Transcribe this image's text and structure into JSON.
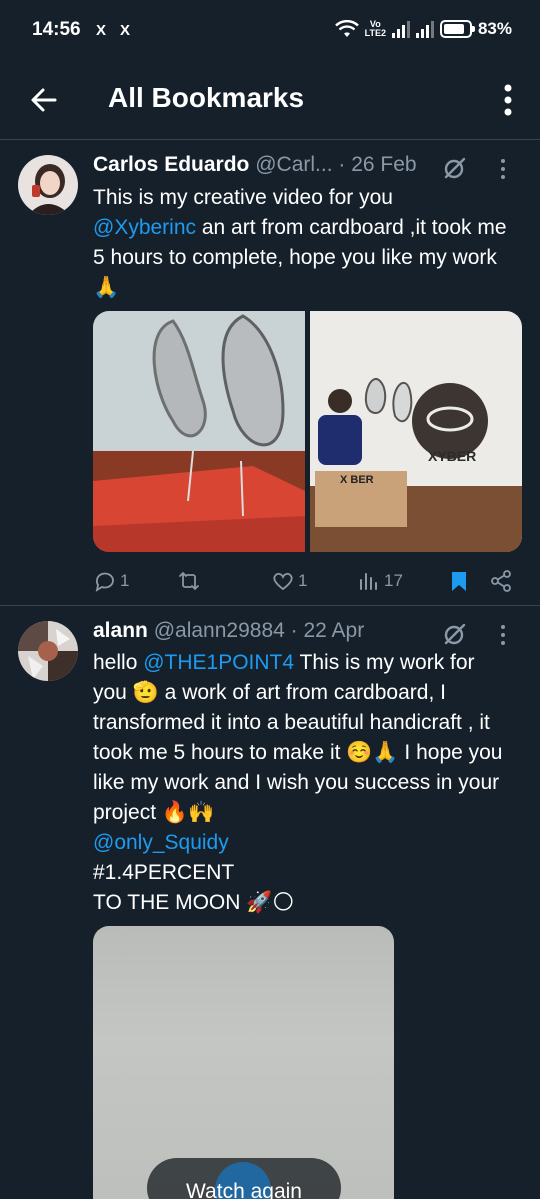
{
  "status_bar": {
    "time": "14:56",
    "notif_1": "X",
    "notif_2": "X",
    "volte_top": "Vo",
    "volte_bottom": "LTE2",
    "battery": "83%"
  },
  "header": {
    "title": "All Bookmarks"
  },
  "tweets": [
    {
      "name": "Carlos Eduardo",
      "handle": "@Carl...",
      "date": "· 26 Feb",
      "text_1": "This is my creative video for you",
      "mention": "@Xyberinc",
      "text_2": " an art from cardboard ,it took me 5 hours to complete, hope you like my work 🙏",
      "image_logo_text": "XYBER",
      "image_box_text": "X BER",
      "replies": "1",
      "likes": "1",
      "views": "17",
      "bookmarked": true
    },
    {
      "name": "alann",
      "handle": "@alann29884",
      "date": "· 22 Apr",
      "text_1": "hello ",
      "mention_1": "@THE1POINT4",
      "text_2": " This is my work for you 🫡 a work of art from cardboard, I transformed it into a beautiful handicraft  , it took me 5 hours to make it ☺️🙏  I hope you like my work and I wish you success in your project 🔥🙌",
      "mention_2": "@only_Squidy",
      "hashtag_line": "#1.4PERCENT",
      "last_line": "TO THE MOON 🚀🌕",
      "watch_label": "Watch again"
    }
  ],
  "colors": {
    "background": "#15202b",
    "divider": "#38444d",
    "accent": "#1d9bf0",
    "secondary_text": "#8b98a5"
  },
  "icons": [
    "back-arrow-icon",
    "more-vert-icon",
    "grok-icon",
    "reply-icon",
    "retweet-icon",
    "like-icon",
    "views-icon",
    "bookmark-icon",
    "share-icon",
    "play-icon"
  ]
}
